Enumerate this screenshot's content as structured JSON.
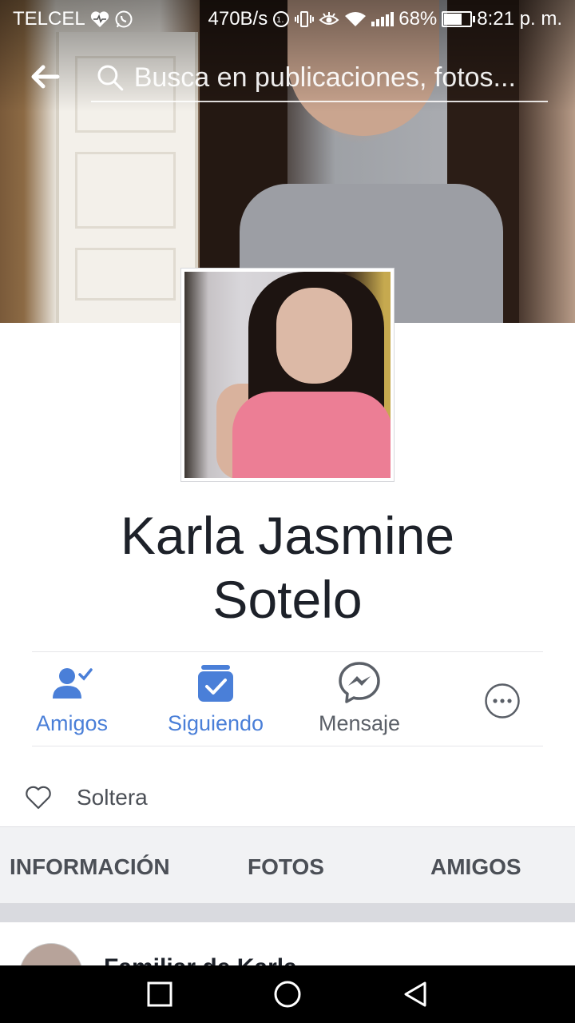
{
  "status_bar": {
    "carrier": "TELCEL",
    "speed": "470B/s",
    "battery": "68%",
    "battery_level": 0.68,
    "time": "8:21 p. m."
  },
  "search": {
    "placeholder": "Busca en publicaciones, fotos..."
  },
  "profile": {
    "name_line1": "Karla Jasmine",
    "name_line2": "Sotelo",
    "relationship": "Soltera"
  },
  "actions": [
    {
      "label": "Amigos",
      "icon": "friends-check-icon"
    },
    {
      "label": "Siguiendo",
      "icon": "following-check-icon"
    },
    {
      "label": "Mensaje",
      "icon": "messenger-icon"
    },
    {
      "label": "",
      "icon": "more-icon"
    }
  ],
  "tabs": [
    "INFORMACIÓN",
    "FOTOS",
    "AMIGOS"
  ],
  "post": {
    "author_partial": "Familiar de Karla"
  },
  "colors": {
    "accent": "#4a7fd8",
    "text": "#1d2129",
    "muted": "#5b6068",
    "tab_bg": "#f1f2f4"
  }
}
